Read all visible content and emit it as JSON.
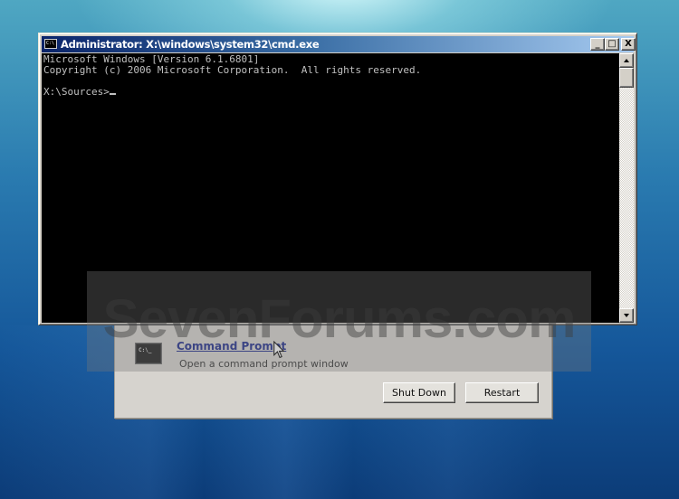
{
  "desktop": {
    "wallpaper": "windows-7-blue"
  },
  "recovery_dialog": {
    "option": {
      "icon": "cmd-icon",
      "icon_text": "C:\\_",
      "title": "Command Prompt",
      "description": "Open a command prompt window"
    },
    "buttons": {
      "shutdown_label": "Shut Down",
      "restart_label": "Restart"
    }
  },
  "cmd_window": {
    "title": "Administrator: X:\\windows\\system32\\cmd.exe",
    "title_icon_text": "C:\\",
    "controls": {
      "minimize": "_",
      "maximize": "□",
      "close": "X"
    },
    "console_lines": [
      "Microsoft Windows [Version 6.1.6801]",
      "Copyright (c) 2006 Microsoft Corporation.  All rights reserved.",
      "",
      "X:\\Sources>"
    ]
  },
  "watermark": {
    "text": "SevenForums.com"
  }
}
